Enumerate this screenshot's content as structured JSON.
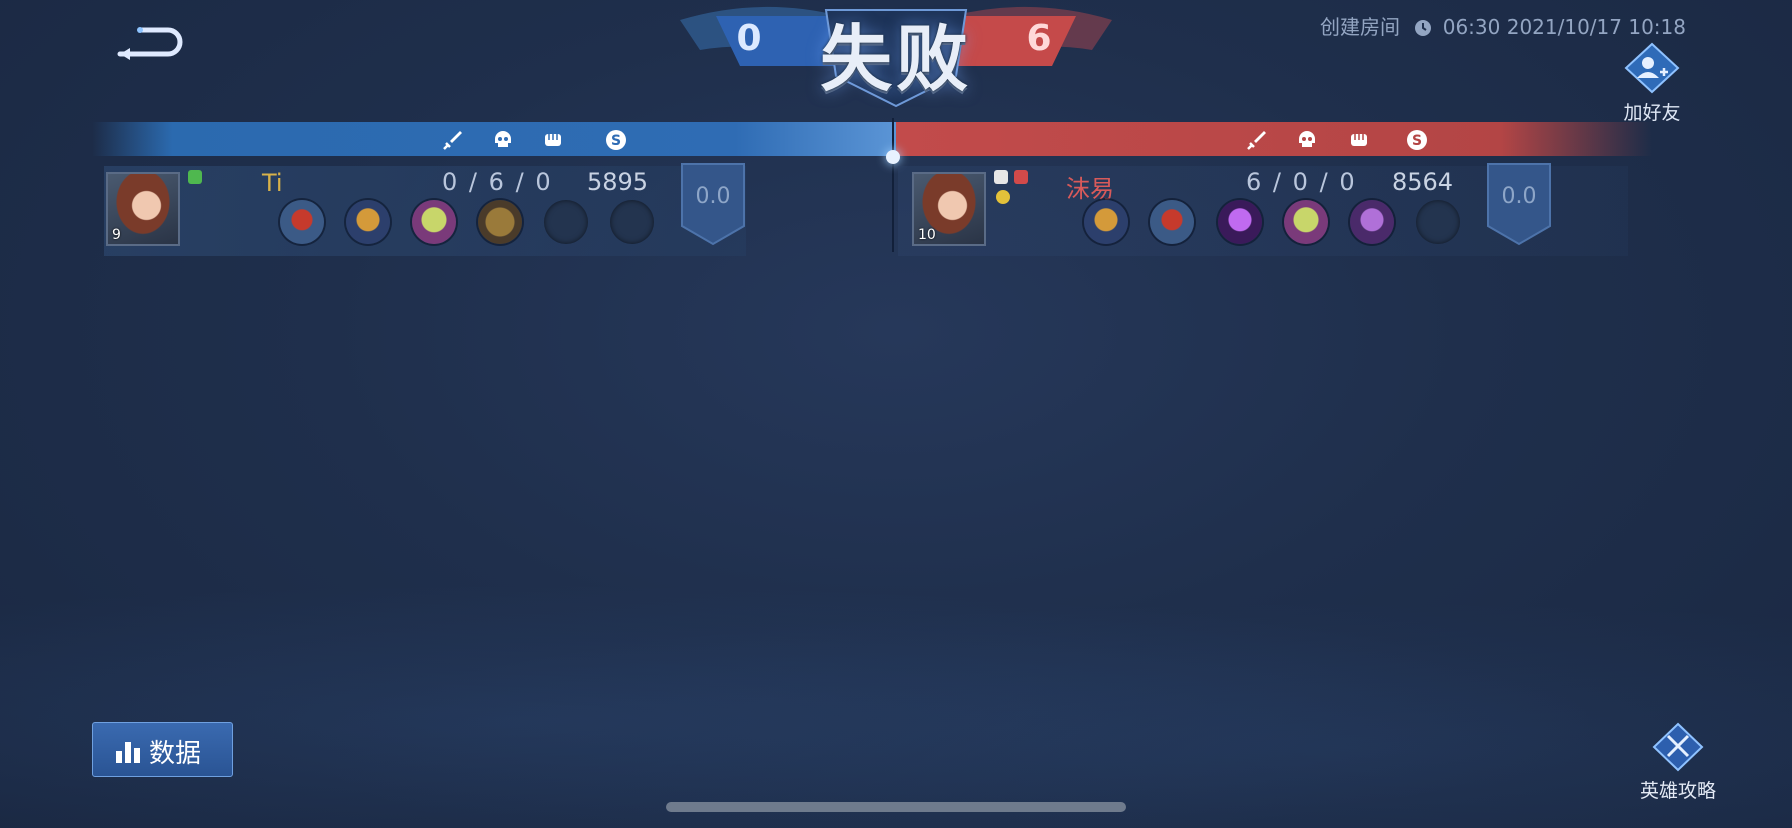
{
  "header": {
    "result": "失败",
    "score_left": "0",
    "score_right": "6",
    "room_label": "创建房间",
    "duration": "06:30",
    "datetime": "2021/10/17 10:18",
    "add_friend_label": "加好友"
  },
  "left_team": {
    "player": {
      "name": "Ti",
      "level": "9",
      "kills": "0",
      "deaths": "6",
      "assists": "0",
      "gold": "5895",
      "rating": "0.0",
      "items": [
        "boots-item-icon",
        "goblet-item-icon",
        "book-item-icon",
        "tome-item-icon",
        "empty",
        "empty"
      ]
    }
  },
  "right_team": {
    "player": {
      "name": "沫易",
      "level": "10",
      "kills": "6",
      "deaths": "0",
      "assists": "0",
      "gold": "8564",
      "rating": "0.0",
      "items": [
        "goblet-item-icon",
        "boots-item-icon",
        "trident-item-icon",
        "book-item-icon",
        "scepter-item-icon",
        "empty"
      ]
    }
  },
  "kda_separator": "/",
  "footer": {
    "data_button_label": "数据",
    "hero_guide_label": "英雄攻略"
  },
  "colors": {
    "left_team": "#2f6cb4",
    "right_team": "#b34545",
    "left_name": "#d8b24a",
    "right_name": "#d85a5a"
  }
}
